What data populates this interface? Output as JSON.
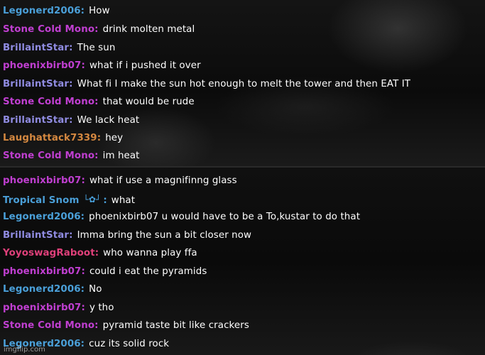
{
  "colors": {
    "blue": "#4a9fd8",
    "magenta": "#c03fd1",
    "periwinkle": "#8f8be0",
    "orange": "#d48840",
    "pink": "#e0407a",
    "message_text": "#ffffff"
  },
  "chat_top": [
    {
      "user": "Legonerd2006",
      "color": "#4a9fd8",
      "text": "How"
    },
    {
      "user": "Stone Cold Mono",
      "color": "#c03fd1",
      "text": "drink molten metal"
    },
    {
      "user": "BrillaintStar",
      "color": "#8f8be0",
      "text": "The sun"
    },
    {
      "user": "phoenixbirb07",
      "color": "#c03fd1",
      "text": "what if i pushed it over"
    },
    {
      "user": "BrillaintStar",
      "color": "#8f8be0",
      "text": "What fi I make the sun hot enough to melt the tower and then EAT IT"
    },
    {
      "user": "Stone Cold Mono",
      "color": "#c03fd1",
      "text": "that would be rude"
    },
    {
      "user": "BrillaintStar",
      "color": "#8f8be0",
      "text": "We lack heat"
    },
    {
      "user": "Laughattack7339",
      "color": "#d48840",
      "text": "hey"
    },
    {
      "user": "Stone Cold Mono",
      "color": "#c03fd1",
      "text": "im heat"
    }
  ],
  "chat_bottom": [
    {
      "user": "phoenixbirb07",
      "color": "#c03fd1",
      "text": "what if use a magnifinng glass"
    },
    {
      "user": "Tropical Snom",
      "color": "#4a9fd8",
      "badge": "└✿┘",
      "text": "what"
    },
    {
      "user": "Legonerd2006",
      "color": "#4a9fd8",
      "text": "phoenixbirb07 u would have to be a To,kustar to do that"
    },
    {
      "user": "BrillaintStar",
      "color": "#8f8be0",
      "text": "Imma bring the sun a bit closer now"
    },
    {
      "user": "YoyoswagRaboot",
      "color": "#e0407a",
      "text": "who wanna play ffa"
    },
    {
      "user": "phoenixbirb07",
      "color": "#c03fd1",
      "text": "could i eat the pyramids"
    },
    {
      "user": "Legonerd2006",
      "color": "#4a9fd8",
      "text": "No"
    },
    {
      "user": "phoenixbirb07",
      "color": "#c03fd1",
      "text": "y tho"
    },
    {
      "user": "Stone Cold Mono",
      "color": "#c03fd1",
      "text": "pyramid taste bit like crackers"
    },
    {
      "user": "Legonerd2006",
      "color": "#4a9fd8",
      "text": "cuz its solid rock"
    }
  ],
  "watermark": "imgflip.com"
}
